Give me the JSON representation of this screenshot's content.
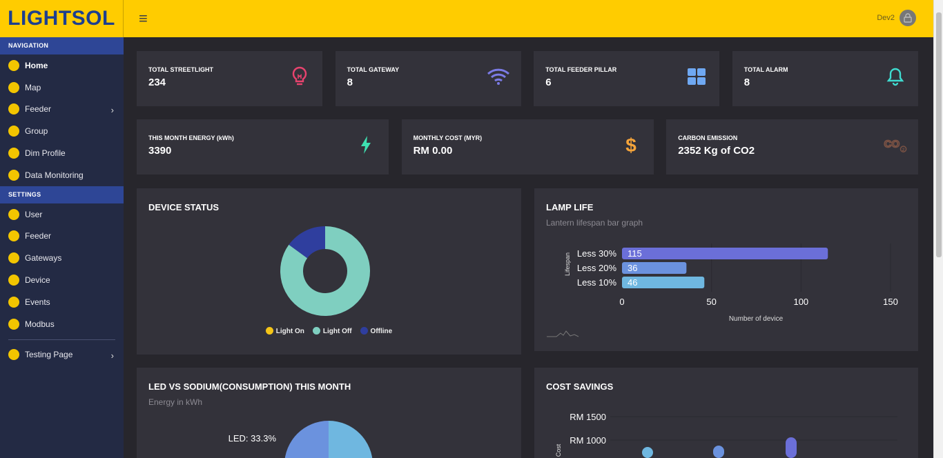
{
  "app": {
    "logo": "LIGHTSOL",
    "user": "Dev2"
  },
  "sidebar": {
    "nav_header": "NAVIGATION",
    "nav_items": [
      {
        "label": "Home",
        "icon": "list-icon",
        "active": true
      },
      {
        "label": "Map",
        "icon": "map-pin-icon"
      },
      {
        "label": "Feeder",
        "icon": "feed-icon",
        "chevron": true
      },
      {
        "label": "Group",
        "icon": "group-icon"
      },
      {
        "label": "Dim Profile",
        "icon": "dim-icon"
      },
      {
        "label": "Data Monitoring",
        "icon": "chart-icon"
      }
    ],
    "settings_header": "SETTINGS",
    "settings_items": [
      {
        "label": "User",
        "icon": "lock-icon"
      },
      {
        "label": "Feeder",
        "icon": "feed-icon"
      },
      {
        "label": "Gateways",
        "icon": "gateway-icon"
      },
      {
        "label": "Device",
        "icon": "device-icon"
      },
      {
        "label": "Events",
        "icon": "calendar-icon"
      },
      {
        "label": "Modbus",
        "icon": "gear-icon"
      }
    ],
    "extra_items": [
      {
        "label": "Testing Page",
        "icon": "test-icon",
        "chevron": true
      }
    ]
  },
  "stats_row1": [
    {
      "label": "TOTAL STREETLIGHT",
      "value": "234",
      "icon": "bulb-icon",
      "color": "#e7436e"
    },
    {
      "label": "TOTAL GATEWAY",
      "value": "8",
      "icon": "wifi-icon",
      "color": "#7b7be6"
    },
    {
      "label": "TOTAL FEEDER PILLAR",
      "value": "6",
      "icon": "grid-icon",
      "color": "#6fa8f2"
    },
    {
      "label": "TOTAL ALARM",
      "value": "8",
      "icon": "bell-icon",
      "color": "#3fdcd0"
    }
  ],
  "stats_row2": [
    {
      "label": "THIS MONTH ENERGY (kWh)",
      "value": "3390",
      "icon": "bolt-icon",
      "color": "#3ee0b0"
    },
    {
      "label": "MONTHLY COST (MYR)",
      "value": "RM 0.00",
      "icon": "dollar-icon",
      "color": "#f5a43a"
    },
    {
      "label": "CARBON EMISSION",
      "value": "2352 Kg of CO2",
      "icon": "co2-icon",
      "color": "#7a5244"
    }
  ],
  "device_status": {
    "title": "DEVICE STATUS",
    "legend": [
      {
        "label": "Light On",
        "color": "#f5c518"
      },
      {
        "label": "Light Off",
        "color": "#7fcfc0"
      },
      {
        "label": "Offline",
        "color": "#2f3e9e"
      }
    ],
    "chart_data": {
      "type": "pie",
      "donut": true,
      "slices": [
        {
          "label": "Light On",
          "value": 0
        },
        {
          "label": "Light Off",
          "value": 85
        },
        {
          "label": "Offline",
          "value": 15
        }
      ]
    }
  },
  "lamp_life": {
    "title": "LAMP LIFE",
    "subtitle": "Lantern lifespan bar graph",
    "chart_data": {
      "type": "bar",
      "orientation": "horizontal",
      "categories": [
        "Less 30%",
        "Less 20%",
        "Less 10%"
      ],
      "values": [
        115,
        36,
        46
      ],
      "colors": [
        "#6b6fd8",
        "#6b92de",
        "#6fb7e0"
      ],
      "xlabel": "Number of device",
      "ylabel": "Lifespan",
      "xlim": [
        0,
        150
      ],
      "xticks": [
        "0",
        "50",
        "100",
        "150"
      ]
    }
  },
  "led_vs_sodium": {
    "title": "LED VS SODIUM(CONSUMPTION) THIS MONTH",
    "subtitle": "Energy in kWh",
    "chart_data": {
      "type": "pie",
      "slices": [
        {
          "label": "LED: 33.3%",
          "value": 33.3
        }
      ]
    }
  },
  "cost_savings": {
    "title": "COST SAVINGS",
    "chart_data": {
      "type": "bar",
      "ylabel": "Cost",
      "yticks": [
        "RM 1500",
        "RM 1000"
      ]
    }
  }
}
